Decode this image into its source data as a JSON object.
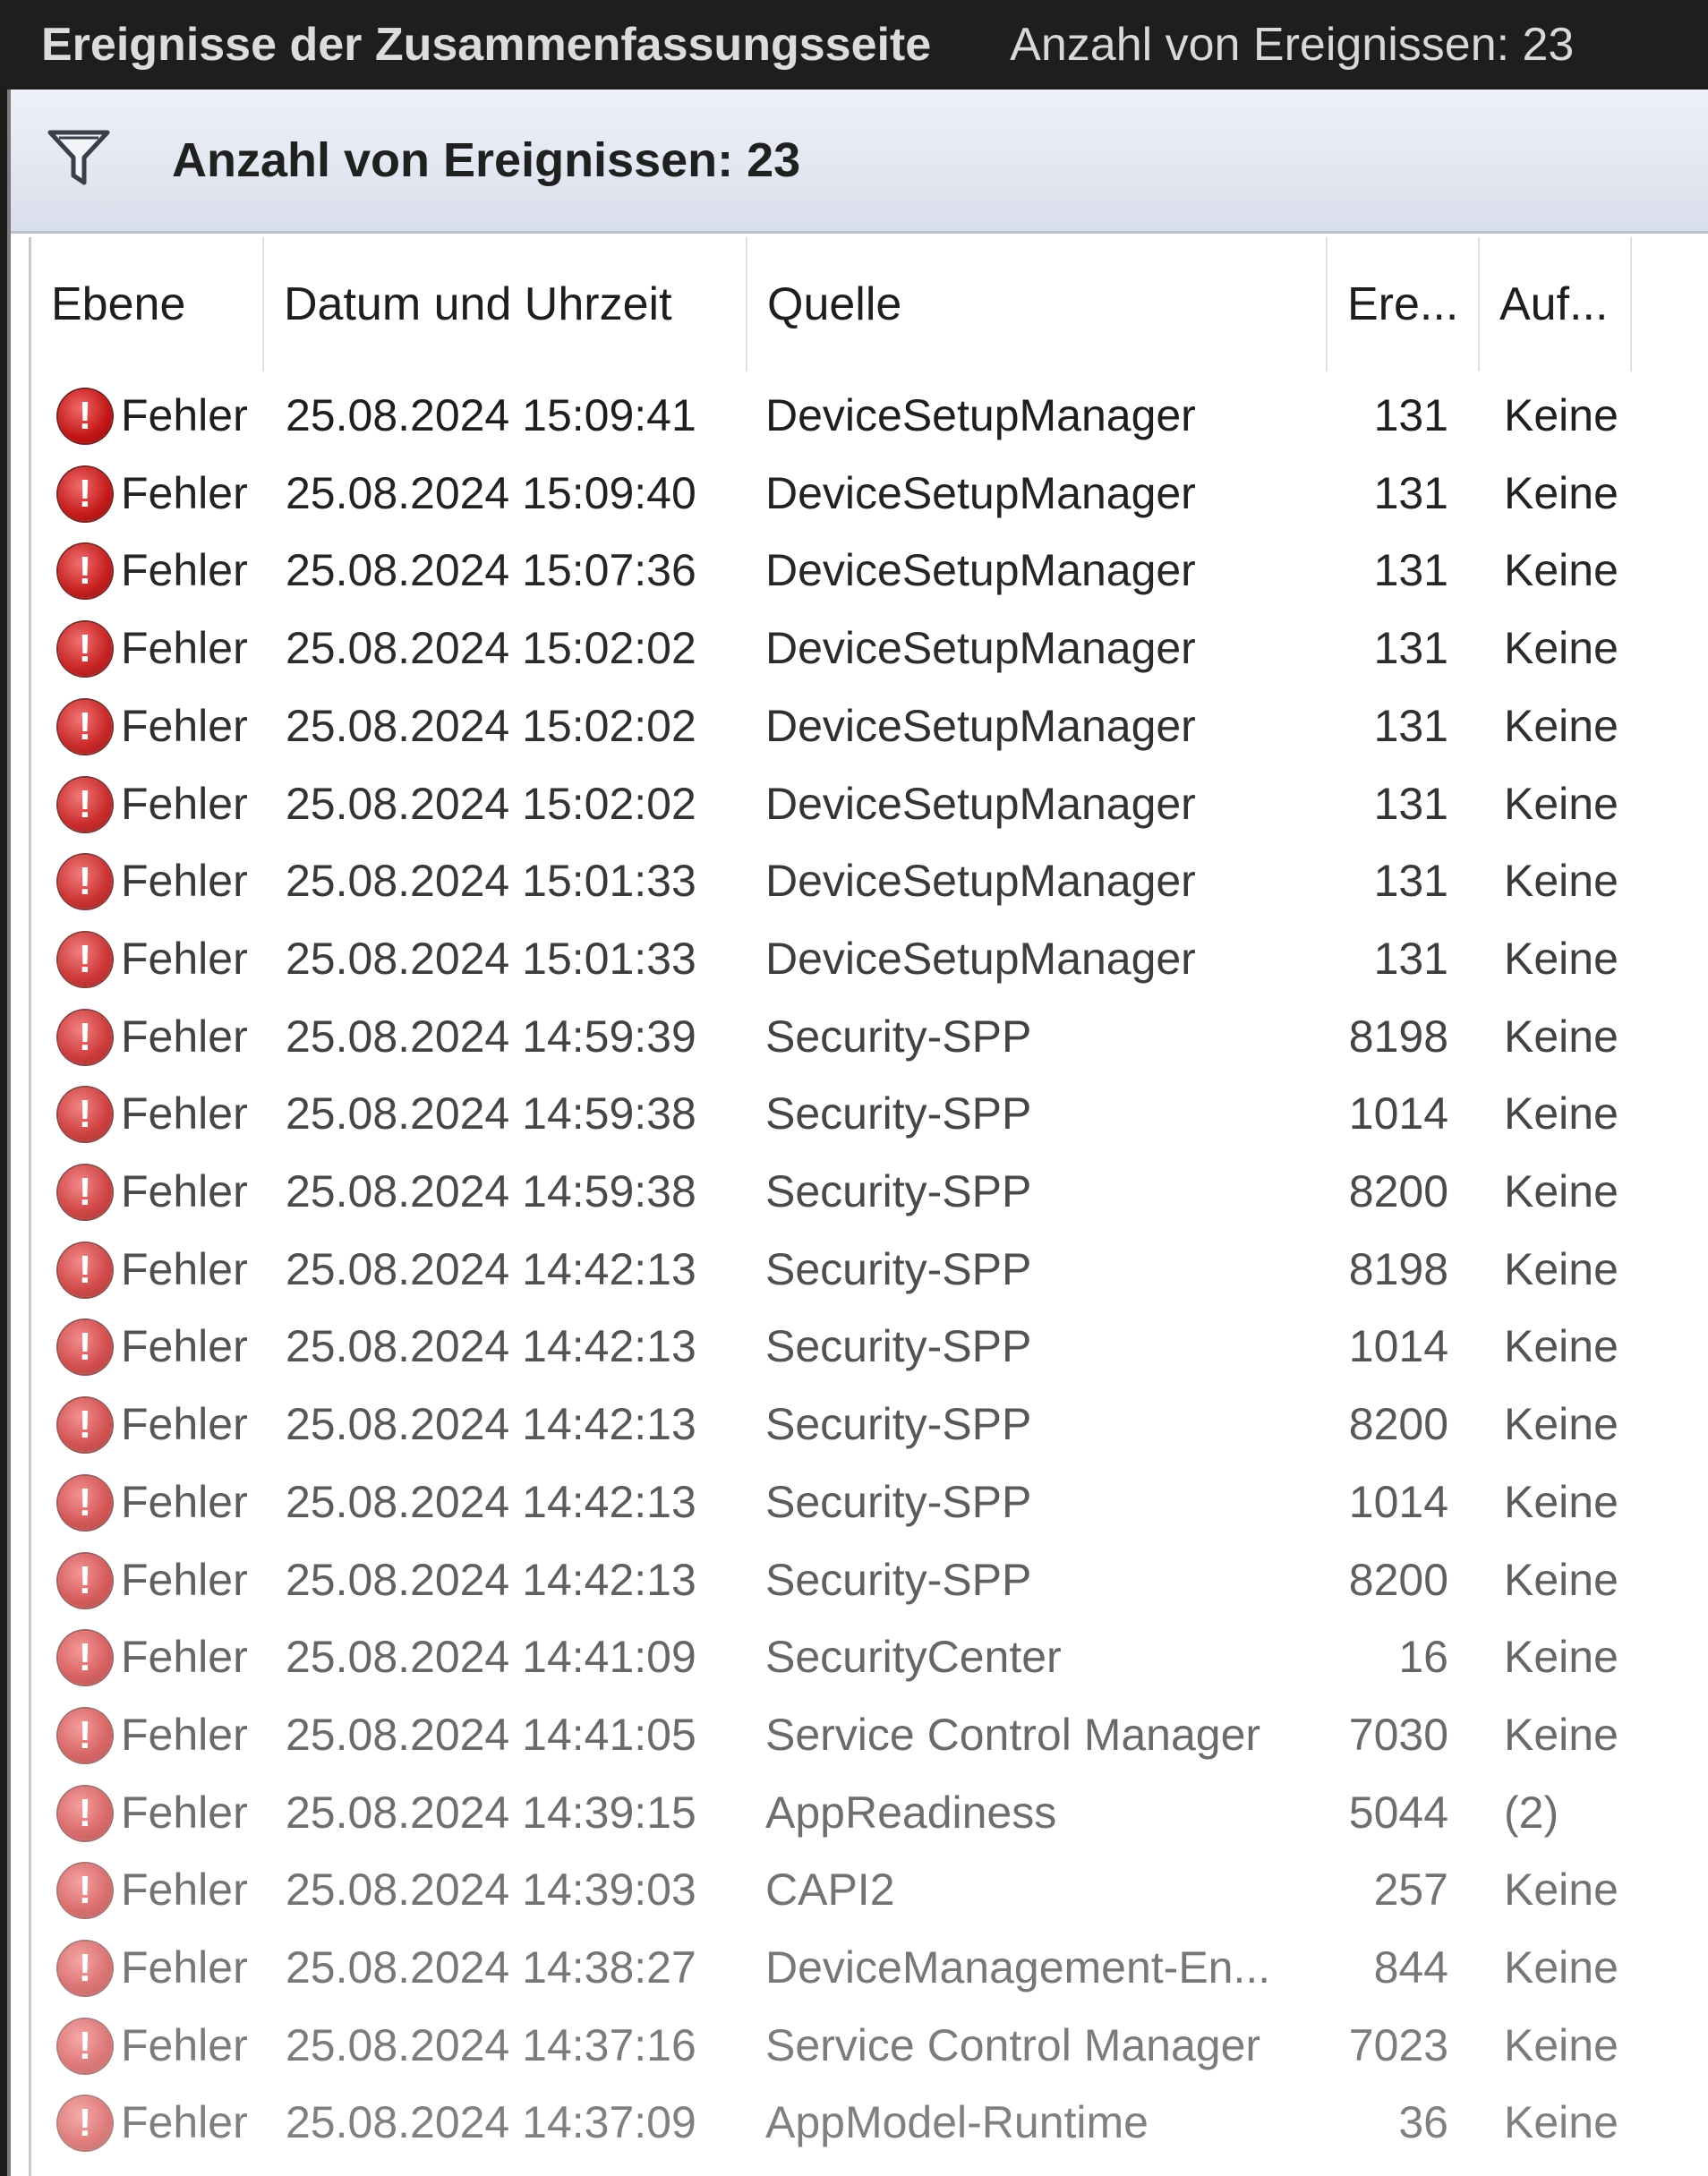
{
  "window": {
    "title": "Ereignisse der Zusammenfassungsseite",
    "count_label": "Anzahl von Ereignissen: 23"
  },
  "filter_bar": {
    "icon": "filter-icon",
    "text": "Anzahl von Ereignissen: 23"
  },
  "columns": {
    "level": "Ebene",
    "datetime": "Datum und Uhrzeit",
    "source": "Quelle",
    "event_id": "Ere...",
    "task": "Auf..."
  },
  "level_icon": "error-icon",
  "level_icon_color": "#c41616",
  "rows": [
    {
      "level": "Fehler",
      "datetime": "25.08.2024 15:09:41",
      "source": "DeviceSetupManager",
      "event_id": "131",
      "task": "Keine"
    },
    {
      "level": "Fehler",
      "datetime": "25.08.2024 15:09:40",
      "source": "DeviceSetupManager",
      "event_id": "131",
      "task": "Keine"
    },
    {
      "level": "Fehler",
      "datetime": "25.08.2024 15:07:36",
      "source": "DeviceSetupManager",
      "event_id": "131",
      "task": "Keine"
    },
    {
      "level": "Fehler",
      "datetime": "25.08.2024 15:02:02",
      "source": "DeviceSetupManager",
      "event_id": "131",
      "task": "Keine"
    },
    {
      "level": "Fehler",
      "datetime": "25.08.2024 15:02:02",
      "source": "DeviceSetupManager",
      "event_id": "131",
      "task": "Keine"
    },
    {
      "level": "Fehler",
      "datetime": "25.08.2024 15:02:02",
      "source": "DeviceSetupManager",
      "event_id": "131",
      "task": "Keine"
    },
    {
      "level": "Fehler",
      "datetime": "25.08.2024 15:01:33",
      "source": "DeviceSetupManager",
      "event_id": "131",
      "task": "Keine"
    },
    {
      "level": "Fehler",
      "datetime": "25.08.2024 15:01:33",
      "source": "DeviceSetupManager",
      "event_id": "131",
      "task": "Keine"
    },
    {
      "level": "Fehler",
      "datetime": "25.08.2024 14:59:39",
      "source": "Security-SPP",
      "event_id": "8198",
      "task": "Keine"
    },
    {
      "level": "Fehler",
      "datetime": "25.08.2024 14:59:38",
      "source": "Security-SPP",
      "event_id": "1014",
      "task": "Keine"
    },
    {
      "level": "Fehler",
      "datetime": "25.08.2024 14:59:38",
      "source": "Security-SPP",
      "event_id": "8200",
      "task": "Keine"
    },
    {
      "level": "Fehler",
      "datetime": "25.08.2024 14:42:13",
      "source": "Security-SPP",
      "event_id": "8198",
      "task": "Keine"
    },
    {
      "level": "Fehler",
      "datetime": "25.08.2024 14:42:13",
      "source": "Security-SPP",
      "event_id": "1014",
      "task": "Keine"
    },
    {
      "level": "Fehler",
      "datetime": "25.08.2024 14:42:13",
      "source": "Security-SPP",
      "event_id": "8200",
      "task": "Keine"
    },
    {
      "level": "Fehler",
      "datetime": "25.08.2024 14:42:13",
      "source": "Security-SPP",
      "event_id": "1014",
      "task": "Keine"
    },
    {
      "level": "Fehler",
      "datetime": "25.08.2024 14:42:13",
      "source": "Security-SPP",
      "event_id": "8200",
      "task": "Keine"
    },
    {
      "level": "Fehler",
      "datetime": "25.08.2024 14:41:09",
      "source": "SecurityCenter",
      "event_id": "16",
      "task": "Keine"
    },
    {
      "level": "Fehler",
      "datetime": "25.08.2024 14:41:05",
      "source": "Service Control Manager",
      "event_id": "7030",
      "task": "Keine"
    },
    {
      "level": "Fehler",
      "datetime": "25.08.2024 14:39:15",
      "source": "AppReadiness",
      "event_id": "5044",
      "task": "(2)"
    },
    {
      "level": "Fehler",
      "datetime": "25.08.2024 14:39:03",
      "source": "CAPI2",
      "event_id": "257",
      "task": "Keine"
    },
    {
      "level": "Fehler",
      "datetime": "25.08.2024 14:38:27",
      "source": "DeviceManagement-En...",
      "event_id": "844",
      "task": "Keine"
    },
    {
      "level": "Fehler",
      "datetime": "25.08.2024 14:37:16",
      "source": "Service Control Manager",
      "event_id": "7023",
      "task": "Keine"
    },
    {
      "level": "Fehler",
      "datetime": "25.08.2024 14:37:09",
      "source": "AppModel-Runtime",
      "event_id": "36",
      "task": "Keine"
    }
  ]
}
